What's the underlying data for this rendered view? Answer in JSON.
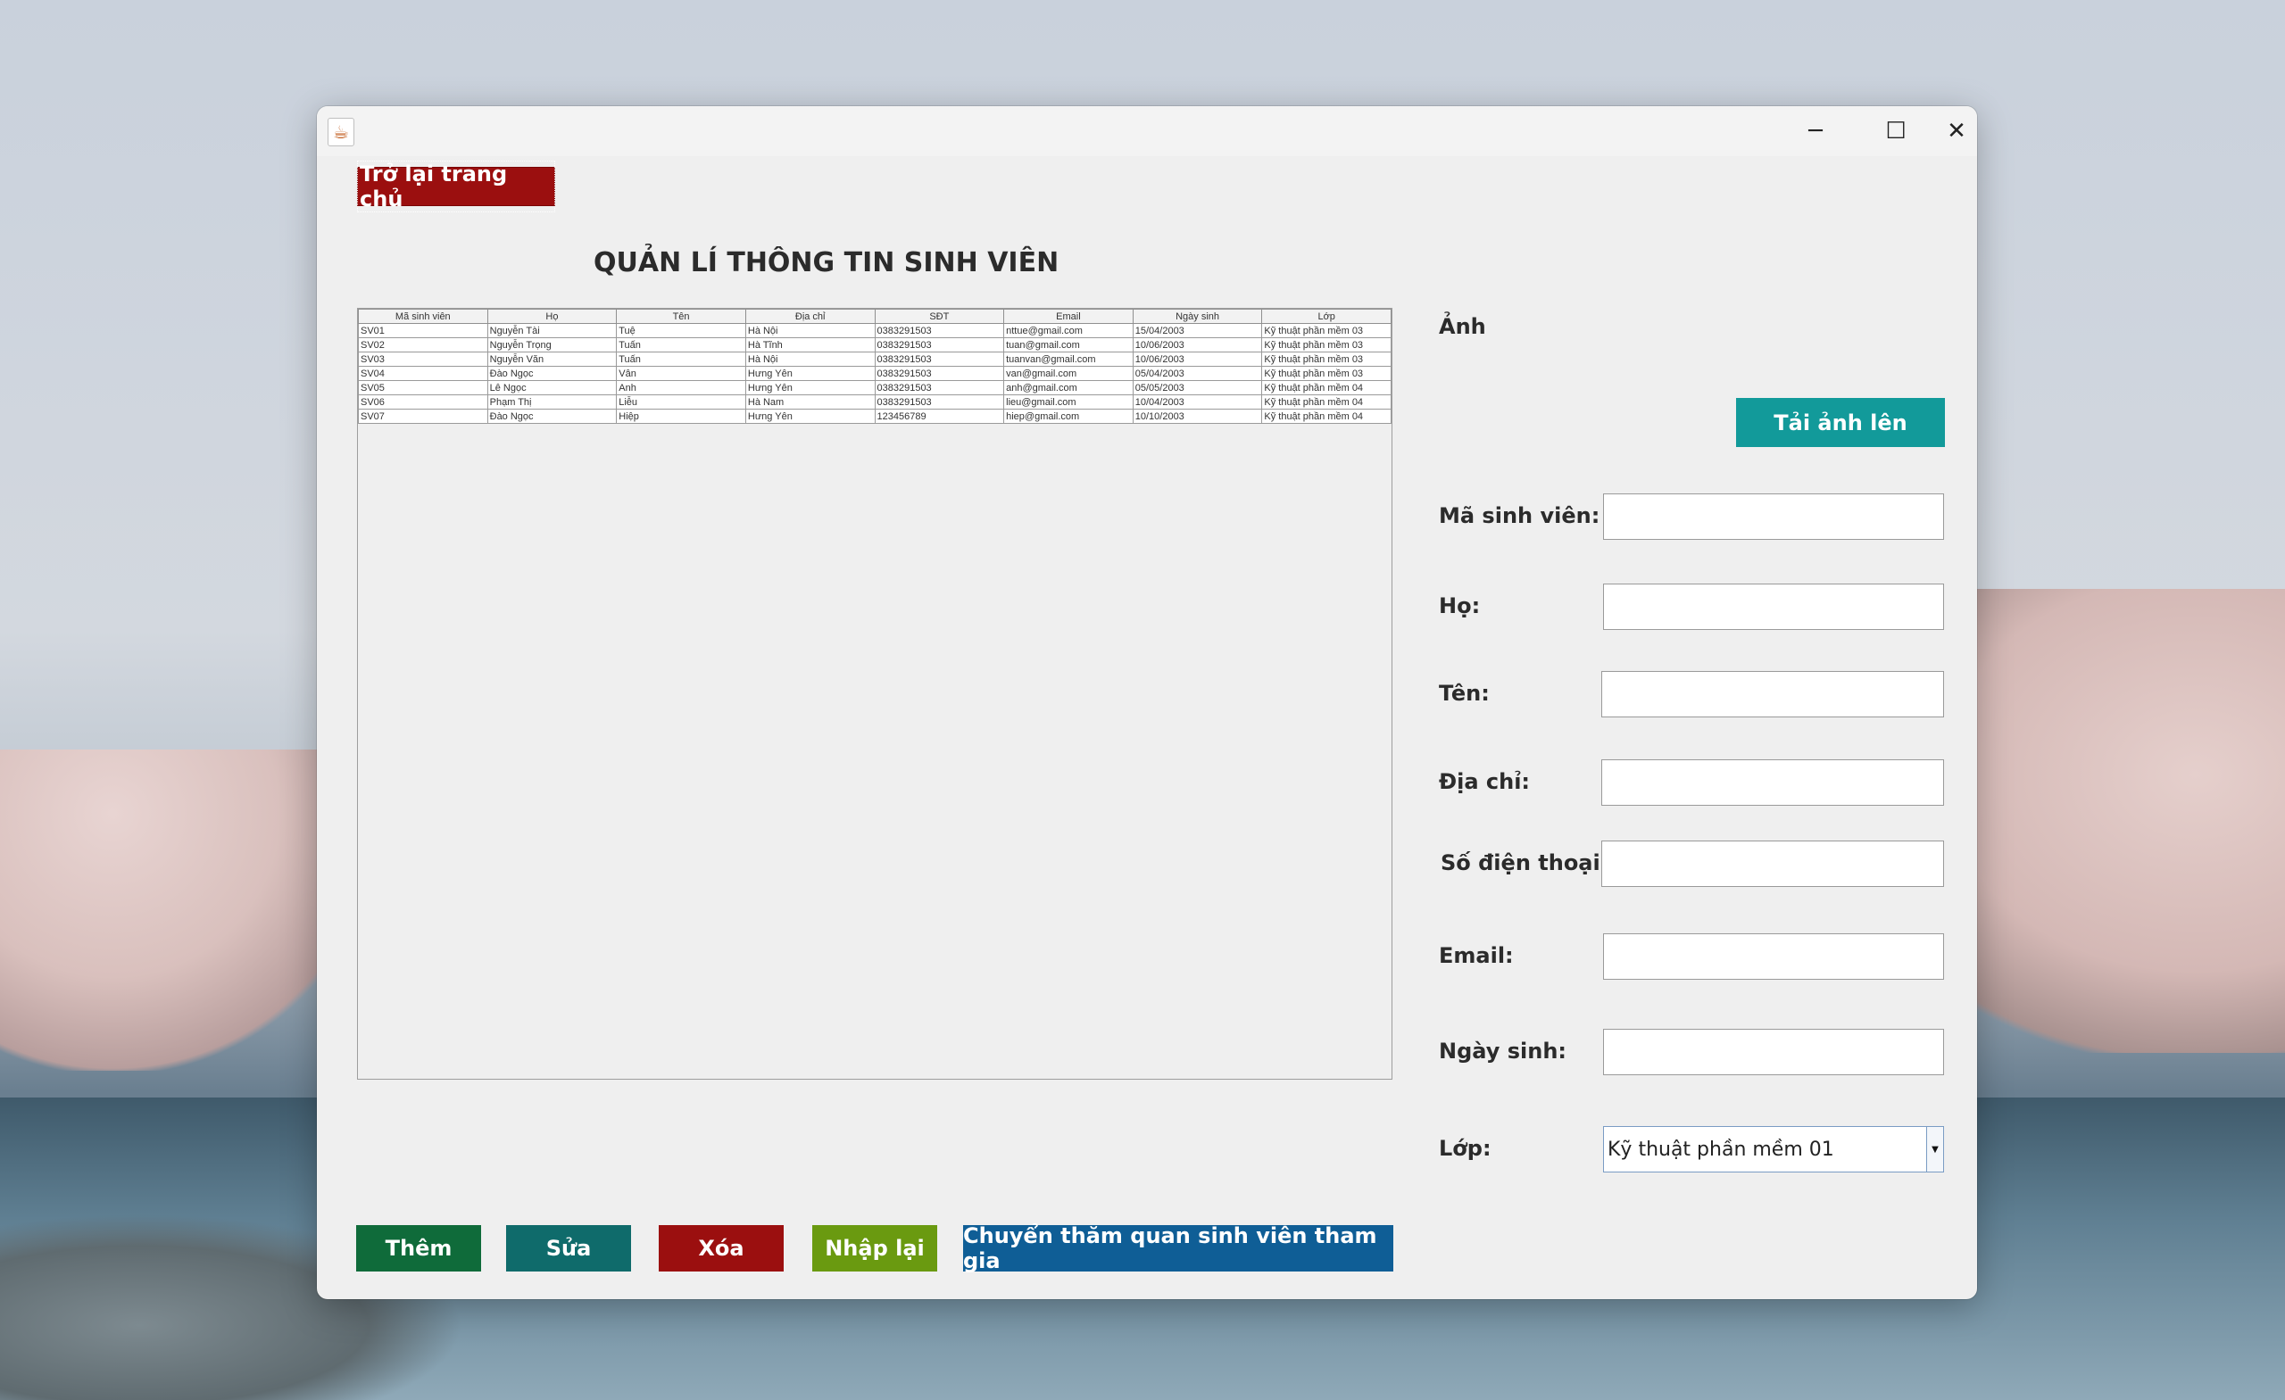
{
  "window": {
    "controls": {
      "minimize": "─",
      "maximize": "☐",
      "close": "✕"
    }
  },
  "back_button": "Trở lại trang chủ",
  "title": "QUẢN LÍ THÔNG TIN SINH VIÊN",
  "table": {
    "columns": [
      "Mã sinh viên",
      "Họ",
      "Tên",
      "Địa chỉ",
      "SĐT",
      "Email",
      "Ngày sinh",
      "Lớp"
    ],
    "rows": [
      [
        "SV01",
        "Nguyễn Tài",
        "Tuệ",
        "Hà Nội",
        "0383291503",
        "nttue@gmail.com",
        "15/04/2003",
        "Kỹ thuật phần mềm 03"
      ],
      [
        "SV02",
        "Nguyễn Trọng",
        "Tuấn",
        "Hà Tĩnh",
        "0383291503",
        "tuan@gmail.com",
        "10/06/2003",
        "Kỹ thuật phần mềm 03"
      ],
      [
        "SV03",
        "Nguyễn Văn",
        "Tuấn",
        "Hà Nội",
        "0383291503",
        "tuanvan@gmail.com",
        "10/06/2003",
        "Kỹ thuật phần mềm 03"
      ],
      [
        "SV04",
        "Đào Ngọc",
        "Vân",
        "Hưng Yên",
        "0383291503",
        "van@gmail.com",
        "05/04/2003",
        "Kỹ thuật phần mềm 03"
      ],
      [
        "SV05",
        "Lê Ngọc",
        "Anh",
        "Hưng Yên",
        "0383291503",
        "anh@gmail.com",
        "05/05/2003",
        "Kỹ thuật phần mềm 04"
      ],
      [
        "SV06",
        "Phạm Thị",
        "Liễu",
        "Hà Nam",
        "0383291503",
        "lieu@gmail.com",
        "10/04/2003",
        "Kỹ thuật phần mềm 04"
      ],
      [
        "SV07",
        "Đào Ngọc",
        "Hiệp",
        "Hưng Yên",
        "123456789",
        "hiep@gmail.com",
        "10/10/2003",
        "Kỹ thuật phần mềm 04"
      ]
    ]
  },
  "form": {
    "photo_label": "Ảnh",
    "upload_button": "Tải ảnh lên",
    "labels": {
      "student_id": "Mã sinh viên:",
      "last_name": "Họ:",
      "first_name": "Tên:",
      "address": "Địa chỉ:",
      "phone": "Số điện thoại:",
      "email": "Email:",
      "birthday": "Ngày sinh:",
      "class": "Lớp:"
    },
    "values": {
      "student_id": "",
      "last_name": "",
      "first_name": "",
      "address": "",
      "phone": "",
      "email": "",
      "birthday": ""
    },
    "class_selected": "Kỹ thuật phần mềm 01"
  },
  "actions": {
    "add": "Thêm",
    "edit": "Sửa",
    "delete": "Xóa",
    "reset": "Nhập lại",
    "move": "Chuyển thăm quan sinh viên tham gia"
  }
}
